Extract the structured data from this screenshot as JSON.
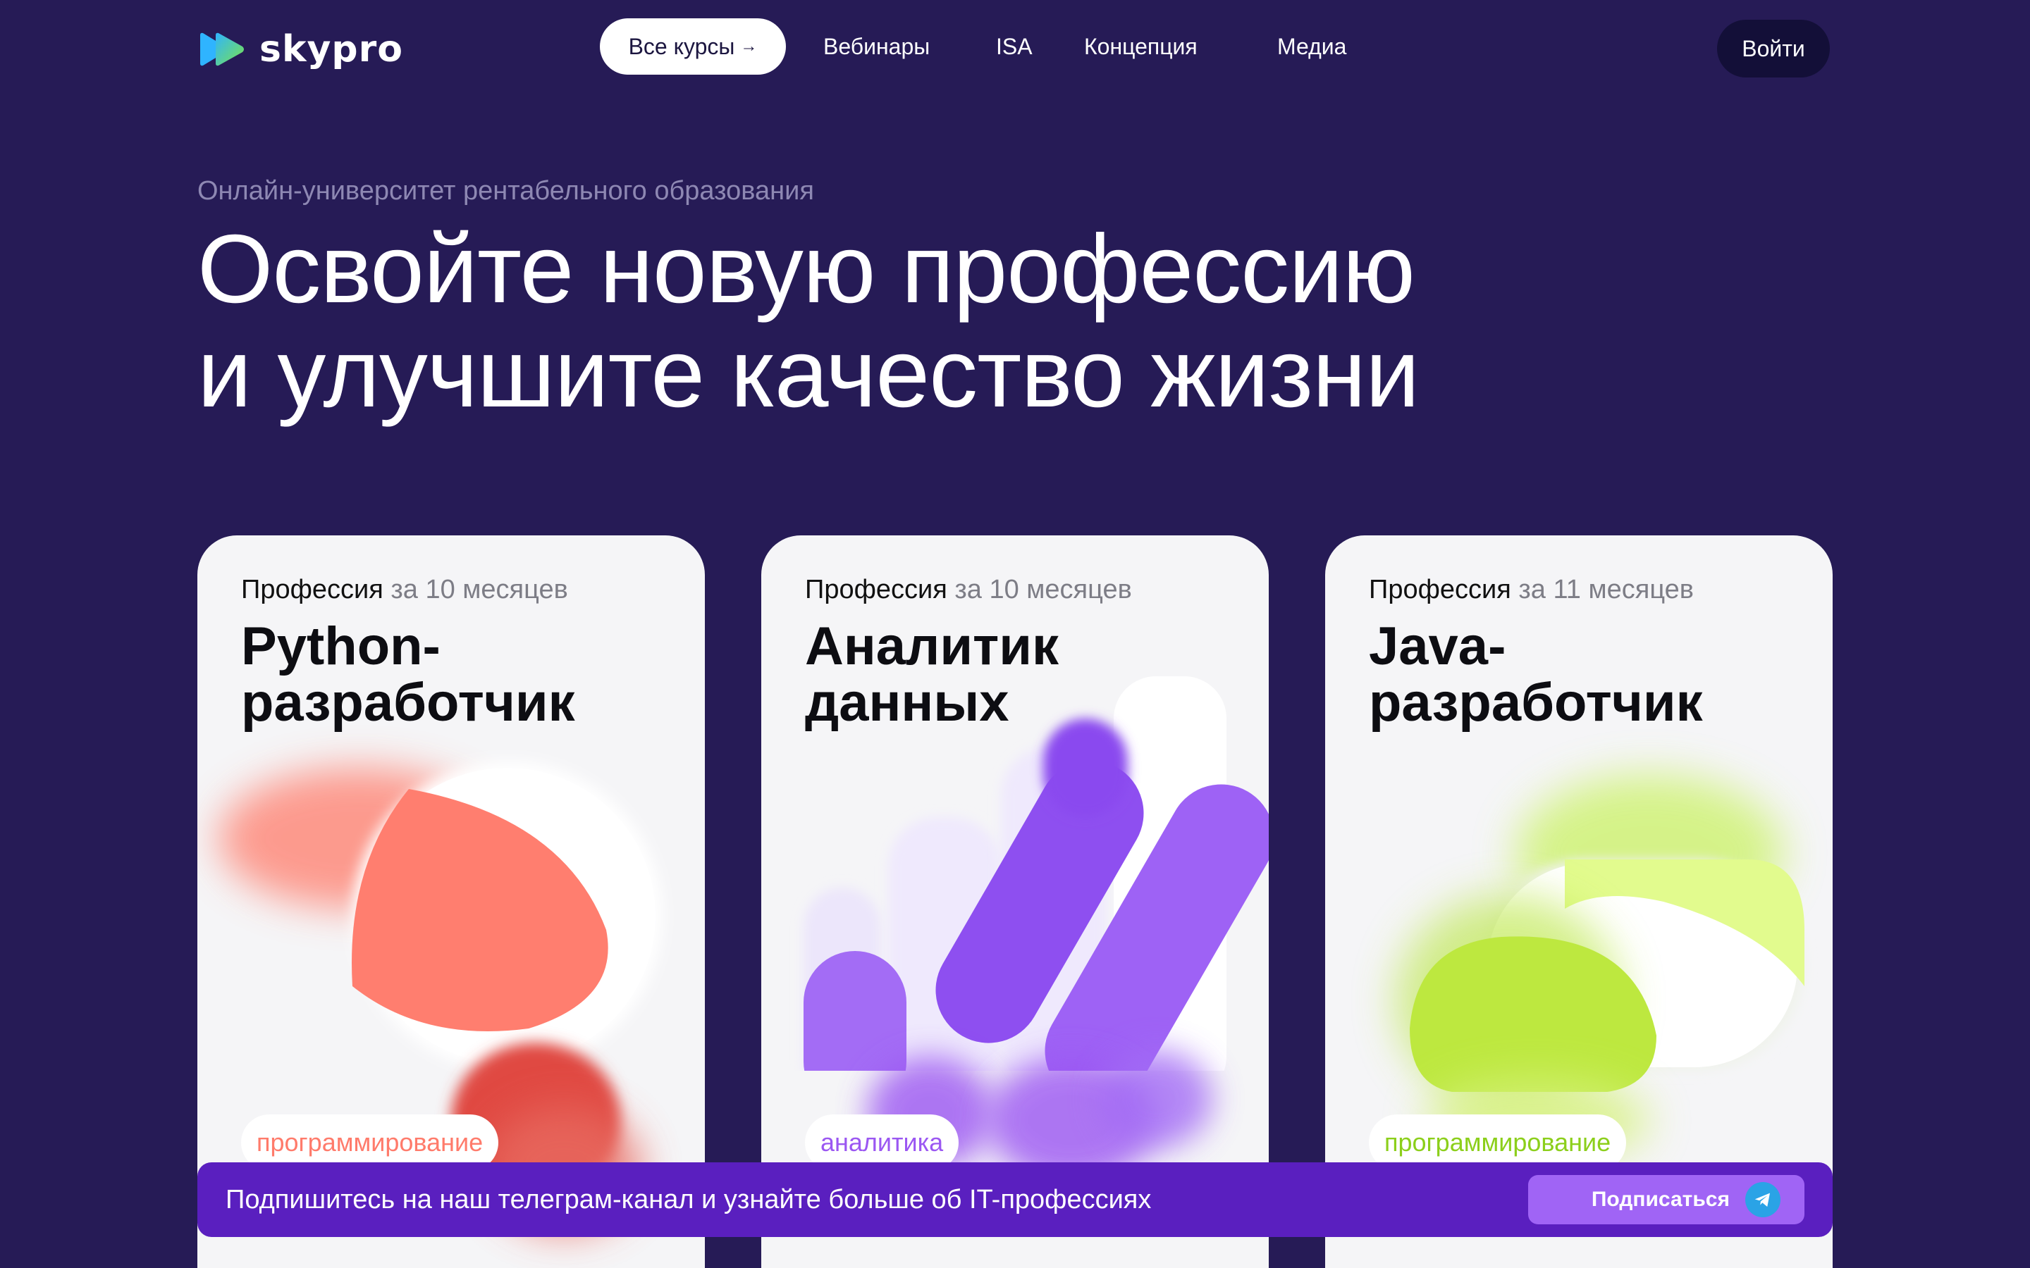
{
  "header": {
    "logo_text": "skypro",
    "nav": {
      "all_courses": "Все курсы",
      "all_courses_arrow": "→",
      "webinars": "Вебинары",
      "isa": "ISA",
      "concept": "Концепция",
      "media": "Медиа"
    },
    "login_label": "Войти"
  },
  "hero": {
    "subtitle": "Онлайн-университет рентабельного образования",
    "title_line1": "Освойте новую профессию",
    "title_line2": "и улучшите качество жизни"
  },
  "cards": [
    {
      "meta_prefix": "Профессия",
      "meta_duration": "за 10 месяцев",
      "title_line1": "Python-",
      "title_line2": "разработчик",
      "tag": "программирование",
      "tag_color": "#ff7b6b"
    },
    {
      "meta_prefix": "Профессия",
      "meta_duration": "за 10 месяцев",
      "title_line1": "Аналитик",
      "title_line2": "данных",
      "tag": "аналитика",
      "tag_color": "#9b57f2"
    },
    {
      "meta_prefix": "Профессия",
      "meta_duration": "за 11 месяцев",
      "title_line1": "Java-",
      "title_line2": "разработчик",
      "tag": "программирование",
      "tag_color": "#8ccf1b"
    }
  ],
  "banner": {
    "text": "Подпишитесь на наш телеграм-канал и узнайте больше об IT-профессиях",
    "button_label": "Подписаться"
  },
  "colors": {
    "background": "#261b56",
    "banner": "#5a1fbf",
    "subscribe_button": "#a064f5"
  }
}
